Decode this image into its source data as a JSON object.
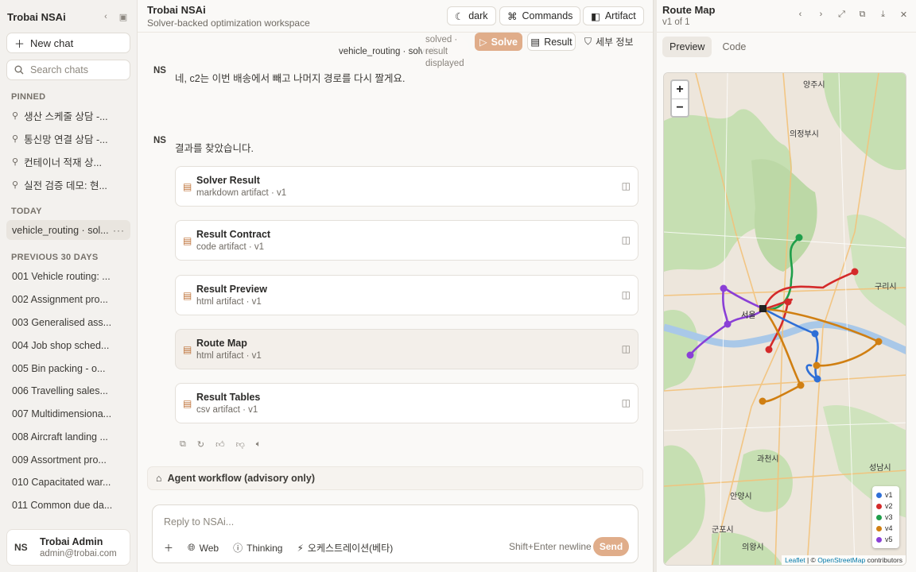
{
  "sidebar": {
    "title": "Trobai NSAi",
    "new_chat": "New chat",
    "search_placeholder": "Search chats",
    "pinned_label": "PINNED",
    "pinned": [
      "생산 스케줄 상담 -...",
      "통신망 연결 상담 -...",
      "컨테이너 적재 상...",
      "실전 검증 데모: 현..."
    ],
    "today_label": "TODAY",
    "today": [
      "vehicle_routing · sol..."
    ],
    "prev_label": "PREVIOUS 30 DAYS",
    "previous": [
      "001 Vehicle routing: ...",
      "002 Assignment pro...",
      "003 Generalised ass...",
      "004 Job shop sched...",
      "005 Bin packing - o...",
      "006 Travelling sales...",
      "007 Multidimensiona...",
      "008 Aircraft landing ...",
      "009 Assortment pro...",
      "010 Capacitated war...",
      "011 Common due da..."
    ],
    "user": {
      "initials": "NS",
      "name": "Trobai Admin",
      "email": "admin@trobai.com"
    }
  },
  "header": {
    "title": "Trobai NSAi",
    "subtitle": "Solver-backed optimization workspace",
    "theme_btn": "dark",
    "commands_btn": "Commands",
    "artifact_btn": "Artifact"
  },
  "subbar": {
    "title": "vehicle_routing · solved",
    "status_lines": [
      "solved ·",
      "result",
      "displayed"
    ],
    "solve_btn": "Solve",
    "result_btn": "Result",
    "detail_btn": "세부 정보"
  },
  "messages": [
    {
      "initials": "NS",
      "text": "네, c2는 이번 배송에서 빼고 나머지 경로를 다시 짤게요."
    },
    {
      "initials": "NS",
      "text": "결과를 찾았습니다."
    }
  ],
  "artifacts": [
    {
      "title": "Solver Result",
      "meta": "markdown artifact · v1"
    },
    {
      "title": "Result Contract",
      "meta": "code artifact · v1"
    },
    {
      "title": "Result Preview",
      "meta": "html artifact · v1"
    },
    {
      "title": "Route Map",
      "meta": "html artifact · v1"
    },
    {
      "title": "Result Tables",
      "meta": "csv artifact · v1"
    }
  ],
  "workflow_label": "Agent workflow (advisory only)",
  "composer": {
    "placeholder": "Reply to NSAi...",
    "web": "Web",
    "thinking": "Thinking",
    "orchestration": "오케스트레이션(베타)",
    "hint": "Shift+Enter newline",
    "send": "Send"
  },
  "panel": {
    "title": "Route Map",
    "version": "v1 of 1",
    "tab_preview": "Preview",
    "tab_code": "Code",
    "legend": [
      {
        "name": "v1",
        "color": "#2f6fd6"
      },
      {
        "name": "v2",
        "color": "#d42a2a"
      },
      {
        "name": "v3",
        "color": "#1f9e4a"
      },
      {
        "name": "v4",
        "color": "#d07f12"
      },
      {
        "name": "v5",
        "color": "#8a3fd6"
      }
    ],
    "map_labels": [
      "양주시",
      "의정부시",
      "구리시",
      "서울",
      "과천시",
      "안양시",
      "성남시",
      "군포시",
      "의왕시"
    ],
    "attribution": {
      "leaflet": "Leaflet",
      "osm": "OpenStreetMap",
      "suffix": "contributors"
    }
  },
  "colors": {
    "accent": "#e0ad8a",
    "sidebar_bg": "#f3f1ee",
    "map_park": "#c6dfb2",
    "map_urban": "#ede6dc"
  }
}
